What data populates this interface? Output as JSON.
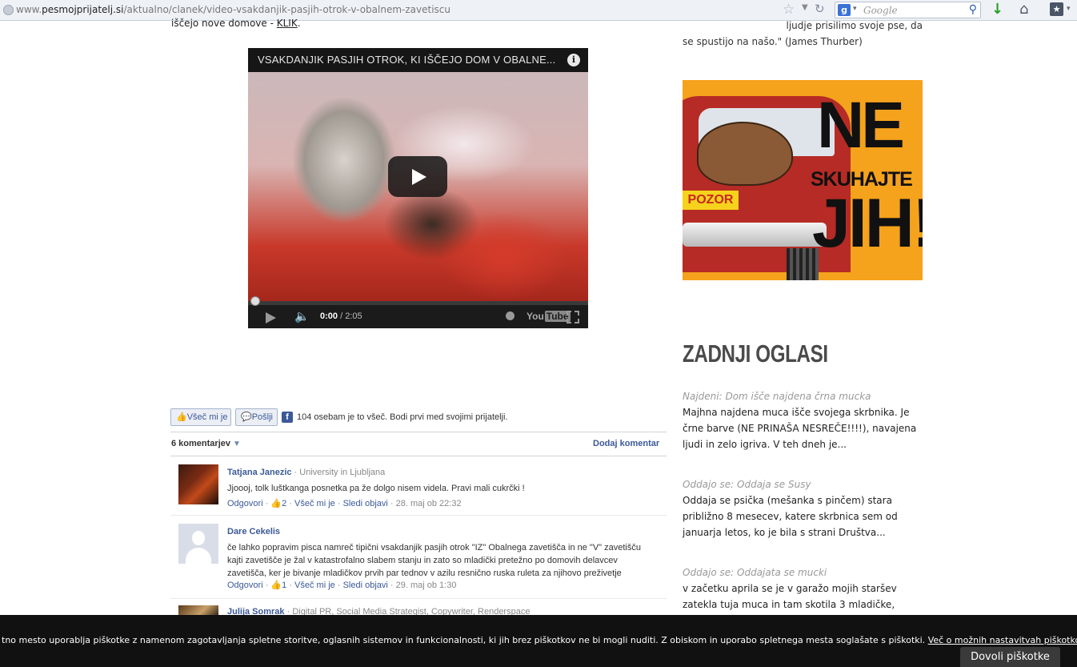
{
  "browser": {
    "url_domain": "www.pesmojprijatelj.si",
    "url_path": "/aktualno/clanek/video-vsakdanjik-pasjih-otrok-v-obalnem-zavetiscu",
    "url_prefix": "www.",
    "url_host": "pesmojprijatelj.si",
    "search_placeholder": "Google"
  },
  "article": {
    "top_text": "iščejo nove domove - ",
    "top_link": "KLIK",
    "top_after": "."
  },
  "video": {
    "title": "VSAKDANJIK PASJIH OTROK, KI IŠČEJO DOM V OBALNE...",
    "time_current": "0:00",
    "time_total": " / 2:05",
    "progress": 0,
    "youtube_label": "You",
    "youtube_label2": "Tube"
  },
  "facebook": {
    "like_label": "Všeč mi je",
    "send_label": "Pošlji",
    "like_count_text": "104 osebam je to všeč. Bodi prvi med svojimi prijatelji.",
    "comment_count": "6 komentarjev",
    "add_comment": "Dodaj komentar",
    "comments": [
      {
        "author": "Tatjana Janezic",
        "affiliation": " · University in Ljubljana",
        "text": "Jjoooj, tolk luštkanga posnetka pa že dolgo nisem videla. Pravi mali cukrčki !",
        "reply": "Odgovori",
        "likes": "2",
        "like": "Všeč mi je",
        "follow": "Sledi objavi",
        "date": "28. maj ob 22:32"
      },
      {
        "author": "Dare Cekelis",
        "affiliation": "",
        "text": "če lahko popravim pisca namreč tipični vsakdanjik pasjih otrok \"IZ\" Obalnega zavetišča in ne \"V\" zavetišču kajti zavetišče je žal v katastrofalno slabem stanju in zato so mladički pretežno po domovih delavcev zavetišča, ker je bivanje mladičkov prvih par tednov v azilu resnično ruska ruleta za njihovo preživetje",
        "reply": "Odgovori",
        "likes": "1",
        "like": "Všeč mi je",
        "follow": "Sledi objavi",
        "date": "29. maj ob 1:30"
      },
      {
        "author": "Julija Somrak",
        "affiliation": " · Digital PR, Social Media Strategist, Copywriter, Renderspace"
      }
    ]
  },
  "sidebar": {
    "quote_line1": "ljudje prisilimo svoje pse, da",
    "quote_line2": "se spustijo na našo.\" (James Thurber)",
    "banner": {
      "pozor": "POZOR",
      "ne": "NE",
      "skuhajte": "SKUHAJTE",
      "jih": "JIH!"
    },
    "heading": "ZADNJI OGLASI",
    "ads": [
      {
        "title": "Najdeni: Dom išče najdena črna mucka",
        "desc": "Majhna najdena muca išče svojega skrbnika. Je črne barve (NE PRINAŠA NESREČE!!!!), navajena ljudi in zelo igriva. V teh dneh je..."
      },
      {
        "title": "Oddajo se: Oddaja se Susy",
        "desc": "Oddaja se psička (mešanka s pinčem) stara približno 8 mesecev, katere skrbnica sem od januarja letos, ko je bila s strani Društva..."
      },
      {
        "title": "Oddajo se: Oddajata se mucki",
        "desc": "v začetku aprila se je v garažo mojih staršev zatekla tuja muca in tam skotila 3 mladičke,"
      }
    ]
  },
  "cookie": {
    "text": "tno mesto uporablja piškotke z namenom zagotavljanja spletne storitve, oglasnih sistemov in funkcionalnosti, ki jih brez piškotkov ne bi mogli nuditi. Z obiskom in uporabo spletnega mesta soglašate s piškotki. ",
    "link": "Več o možnih nastavitvah piškotkov",
    "button": "Dovoli piškotke"
  }
}
